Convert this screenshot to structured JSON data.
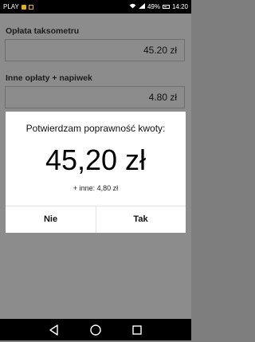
{
  "status_bar": {
    "carrier": "PLAY",
    "battery": "49%",
    "time": "14:20",
    "icons": [
      "notification-icon",
      "notification-icon",
      "wifi-icon",
      "signal-icon",
      "battery-icon"
    ]
  },
  "form": {
    "taximeter_label": "Opłata taksometru",
    "taximeter_value": "45.20 zł",
    "extra_label": "Inne opłaty + napiwek",
    "extra_value": "4.80 zł"
  },
  "dialog": {
    "title": "Potwierdzam poprawność kwoty:",
    "amount": "45,20 zł",
    "extra": "+ inne: 4,80 zł",
    "no_label": "Nie",
    "yes_label": "Tak"
  },
  "nav_bar": {
    "icons": [
      "back-icon",
      "home-icon",
      "recents-icon"
    ]
  },
  "colors": {
    "scrim": "#8c8c8c",
    "dialog_bg": "#ffffff",
    "bars": "#000000"
  }
}
